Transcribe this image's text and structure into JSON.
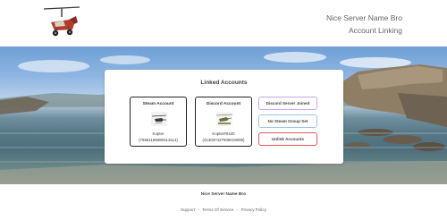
{
  "header": {
    "site_name": "Nice Server Name Bro",
    "page_name": "Account Linking",
    "logo_icon": "gyrocopter-logo-icon"
  },
  "card": {
    "title": "Linked Accounts",
    "steam": {
      "label": "Steam Account",
      "name": "Kopter",
      "id": "(76561198380413114)",
      "icon": "helicopter-icon"
    },
    "discord": {
      "label": "Discord Account",
      "name": "Kopter#0420",
      "id": "(413037427935019009)",
      "icon": "attack-helicopter-icon"
    },
    "actions": {
      "discord_joined": "Discord Server Joined",
      "steam_group": "No Steam Group Set",
      "unlink": "Unlink Accounts"
    }
  },
  "footer": {
    "brand": "Nice Server Name Bro",
    "links": [
      "Support",
      "Terms Of Service",
      "Privacy Policy"
    ],
    "separator": "-"
  },
  "colors": {
    "joined_border": "#c9a8e8",
    "steam_group_border": "#9ec3ea",
    "unlink_border": "#e35a5a"
  }
}
